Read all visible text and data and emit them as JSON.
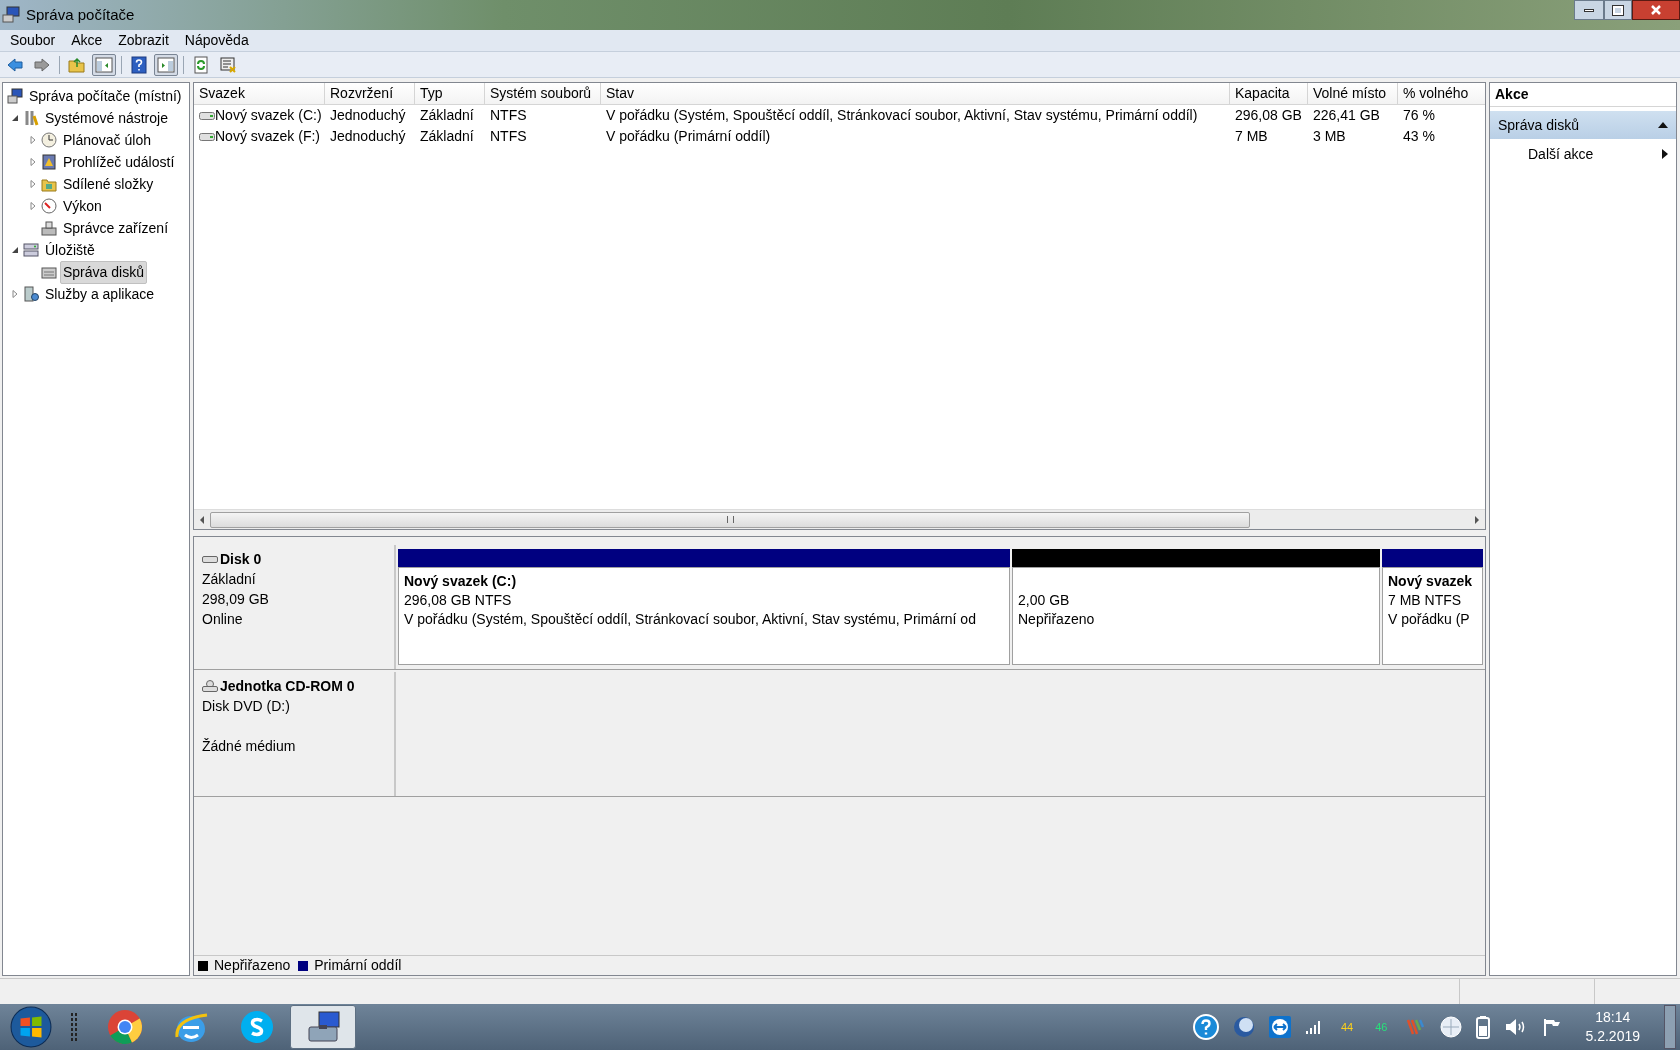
{
  "window": {
    "title": "Správa počítače"
  },
  "menu": [
    "Soubor",
    "Akce",
    "Zobrazit",
    "Nápověda"
  ],
  "toolbar": [
    {
      "pressed": false
    },
    {
      "pressed": false
    },
    {
      "pressed": false
    },
    {
      "pressed": true
    },
    {
      "pressed": false
    },
    {
      "pressed": true
    },
    {
      "pressed": false
    },
    {
      "pressed": false
    }
  ],
  "tree": [
    {
      "label": "Správa počítače (místní)",
      "selected": false,
      "children": [
        {
          "label": "Systémové nástroje",
          "selected": false,
          "expanded": true,
          "children": [
            {
              "label": "Plánovač úloh",
              "selected": false,
              "expanded": false
            },
            {
              "label": "Prohlížeč událostí",
              "selected": false,
              "expanded": false
            },
            {
              "label": "Sdílené složky",
              "selected": false,
              "expanded": false
            },
            {
              "label": "Výkon",
              "selected": false,
              "expanded": false
            },
            {
              "label": "Správce zařízení",
              "selected": false
            }
          ]
        },
        {
          "label": "Úložiště",
          "selected": false,
          "expanded": true,
          "children": [
            {
              "label": "Správa disků",
              "selected": true
            }
          ]
        },
        {
          "label": "Služby a aplikace",
          "selected": false,
          "expanded": false
        }
      ]
    }
  ],
  "table": {
    "columns": [
      "Svazek",
      "Rozvržení",
      "Typ",
      "Systém souborů",
      "Stav",
      "Kapacita",
      "Volné místo",
      "% volného"
    ],
    "rows": [
      [
        "Nový svazek (C:)",
        "Jednoduchý",
        "Základní",
        "NTFS",
        "V pořádku (Systém, Spouštěcí oddíl, Stránkovací soubor, Aktivní, Stav systému, Primární oddíl)",
        "296,08 GB",
        "226,41 GB",
        "76 %"
      ],
      [
        "Nový svazek (F:)",
        "Jednoduchý",
        "Základní",
        "NTFS",
        "V pořádku (Primární oddíl)",
        "7 MB",
        "3 MB",
        "43 %"
      ]
    ]
  },
  "disks": [
    {
      "name": "Disk 0",
      "lines": [
        "Základní",
        "298,09 GB",
        "Online"
      ],
      "partitions": [
        {
          "title": "Nový svazek  (C:)",
          "lines": [
            "296,08 GB NTFS",
            "V pořádku (Systém, Spouštěcí oddíl, Stránkovací soubor, Aktivní, Stav systému, Primární od"
          ],
          "color": "#000080"
        },
        {
          "lines": [
            "2,00 GB",
            "Nepřiřazeno"
          ],
          "color": "#000000"
        },
        {
          "title": "Nový svazek",
          "lines": [
            "7 MB NTFS",
            "V pořádku (P"
          ],
          "color": "#000080"
        }
      ]
    },
    {
      "name": "Jednotka CD-ROM 0",
      "lines": [
        "Disk DVD (D:)"
      ],
      "status": "Žádné médium"
    }
  ],
  "legend": [
    {
      "label": "Nepřiřazeno",
      "color": "#000000"
    },
    {
      "label": "Primární oddíl",
      "color": "#000080"
    }
  ],
  "actions": {
    "title": "Akce",
    "section": "Správa disků",
    "expanded": true,
    "items": [
      "Další akce"
    ]
  },
  "taskbar": {
    "apps": [
      {
        "selected": false
      },
      {
        "selected": false
      },
      {
        "selected": false
      },
      {
        "selected": true
      }
    ],
    "tray_readings": [
      {
        "text": "44",
        "color": "#ffd21a"
      },
      {
        "text": "46",
        "color": "#28e07a"
      }
    ],
    "time": "18:14",
    "date": "5.2.2019"
  }
}
